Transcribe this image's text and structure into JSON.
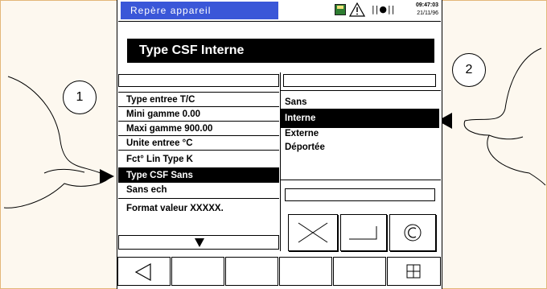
{
  "header": {
    "device_label": "Repère appareil",
    "time": "09:47:03",
    "date": "21/11/96",
    "icons": [
      "disk-icon",
      "warning-icon",
      "signal-icon"
    ]
  },
  "title": "Type CSF Interne",
  "left_menu": [
    "Type entree T/C",
    "Mini gamme  0.00",
    "Maxi gamme  900.00",
    "Unite entree °C",
    "Fct° Lin Type K",
    "Type CSF Sans",
    "Sans ech",
    "Format valeur XXXXX."
  ],
  "left_menu_selected": "Type CSF Sans",
  "right_options": [
    "Sans",
    "Interne",
    "Externe",
    "Déportée"
  ],
  "right_selected": "Interne",
  "callouts": [
    "1",
    "2"
  ],
  "buttons": {
    "cancel": "cancel-icon",
    "enter": "enter-icon",
    "copyright": "copyright-icon"
  },
  "softkeys": [
    "back-triangle-icon",
    "",
    "",
    "",
    "",
    "",
    "grid-icon"
  ],
  "colors": {
    "header_accent": "#3a57d8",
    "frame_border": "#e3b77a",
    "background": "#fdf8ef"
  }
}
